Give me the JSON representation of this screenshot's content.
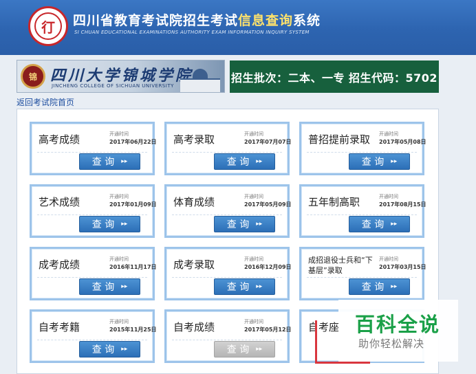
{
  "header": {
    "logo_glyph": "㣔",
    "title_main": "四川省教育考试院招生考试",
    "title_accent": "信息查询",
    "title_end": "系统",
    "subtitle": "SI CHUAN EDUCATIONAL EXAMINATIONS AUTHORITY EXAM INFORMATION INQUIRY SYSTEM"
  },
  "college": {
    "name": "四川大学锦城学院",
    "name_en": "JINCHENG COLLEGE OF SICHUAN UNIVERSITY",
    "emblem": "锦"
  },
  "batch": {
    "text": "招生批次：二本、一专  招生代码：5702"
  },
  "nav": {
    "back_label": "返回考试院首页"
  },
  "cards": [
    {
      "title": "高考成绩",
      "time_label": "开通时间",
      "time": "2017年06月22日",
      "button": "查 询",
      "arrow": "▸▸"
    },
    {
      "title": "高考录取",
      "time_label": "开通时间",
      "time": "2017年07月07日",
      "button": "查 询",
      "arrow": "▸▸"
    },
    {
      "title": "普招提前录取",
      "time_label": "开通时间",
      "time": "2017年05月08日",
      "button": "查 询",
      "arrow": "▸▸"
    },
    {
      "title": "艺术成绩",
      "time_label": "开通时间",
      "time": "2017年01月09日",
      "button": "查 询",
      "arrow": "▸▸"
    },
    {
      "title": "体育成绩",
      "time_label": "开通时间",
      "time": "2017年05月09日",
      "button": "查 询",
      "arrow": "▸▸"
    },
    {
      "title": "五年制高职",
      "time_label": "开通时间",
      "time": "2017年08月15日",
      "button": "查 询",
      "arrow": "▸▸"
    },
    {
      "title": "成考成绩",
      "time_label": "开通时间",
      "time": "2016年11月17日",
      "button": "查 询",
      "arrow": "▸▸"
    },
    {
      "title": "成考录取",
      "time_label": "开通时间",
      "time": "2016年12月09日",
      "button": "查 询",
      "arrow": "▸▸"
    },
    {
      "title": "成招退役士兵和“下基层”录取",
      "time_label": "开通时间",
      "time": "2017年03月15日",
      "button": "查 询",
      "arrow": "▸▸"
    },
    {
      "title": "自考考籍",
      "time_label": "开通时间",
      "time": "2015年11月25日",
      "button": "查 询",
      "arrow": "▸▸"
    },
    {
      "title": "自考成绩",
      "time_label": "开通时间",
      "time": "2017年05月12日",
      "button": "查 询",
      "arrow": "▸▸"
    },
    {
      "title": "自考座",
      "time_label": "",
      "time": "",
      "button": "",
      "arrow": ""
    }
  ],
  "watermark": {
    "main": "百科全说",
    "sub": "助你轻松解决"
  },
  "colors": {
    "header": "#2d64b0",
    "batch_bg": "#17603d",
    "accent": "#ffe26b",
    "button": "#2c6fb7",
    "watermark": "#1aa048"
  }
}
